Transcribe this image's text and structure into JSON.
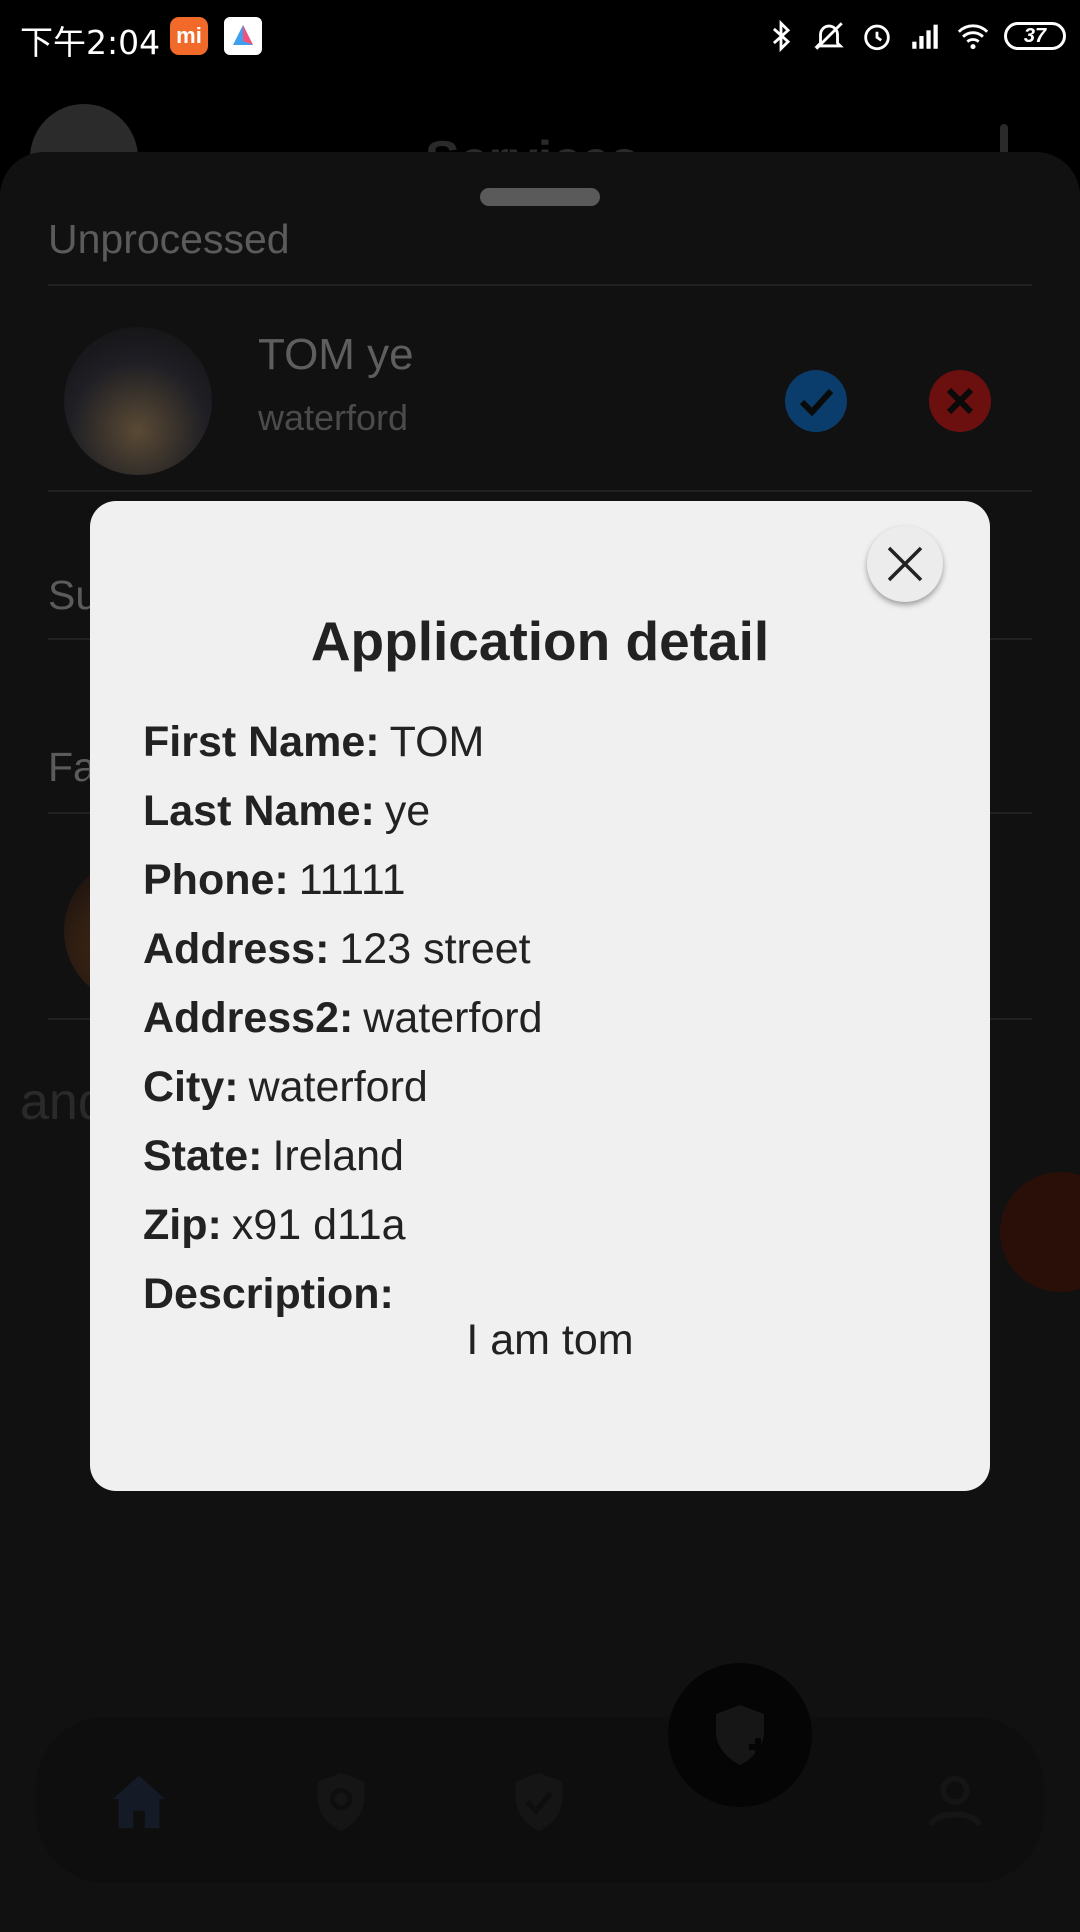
{
  "status_bar": {
    "time": "下午2:04",
    "app_badge": "mi",
    "battery": "37",
    "icons": [
      "bluetooth-icon",
      "bell-off-icon",
      "alarm-icon",
      "signal-icon",
      "wifi-icon",
      "battery-icon"
    ]
  },
  "background": {
    "title": "Services",
    "section_unprocessed": "Unprocessed",
    "request": {
      "name": "TOM ye",
      "location": "waterford"
    },
    "section_2_partial": "Su",
    "section_3_partial": "Fa",
    "partial_text": "and"
  },
  "dialog": {
    "title": "Application detail",
    "fields": [
      {
        "label": "First Name:",
        "value": "TOM"
      },
      {
        "label": "Last Name:",
        "value": "ye"
      },
      {
        "label": "Phone:",
        "value": "11111"
      },
      {
        "label": "Address:",
        "value": "123 street"
      },
      {
        "label": "Address2:",
        "value": "waterford"
      },
      {
        "label": "City:",
        "value": "waterford"
      },
      {
        "label": "State:",
        "value": "Ireland"
      },
      {
        "label": "Zip:",
        "value": "x91 d11a"
      },
      {
        "label": "Description:",
        "value": ""
      }
    ],
    "description": "I am tom"
  },
  "colors": {
    "accept": "#0a3d6b",
    "reject": "#6b0f0f",
    "dialog_bg": "#f0f0f0"
  }
}
